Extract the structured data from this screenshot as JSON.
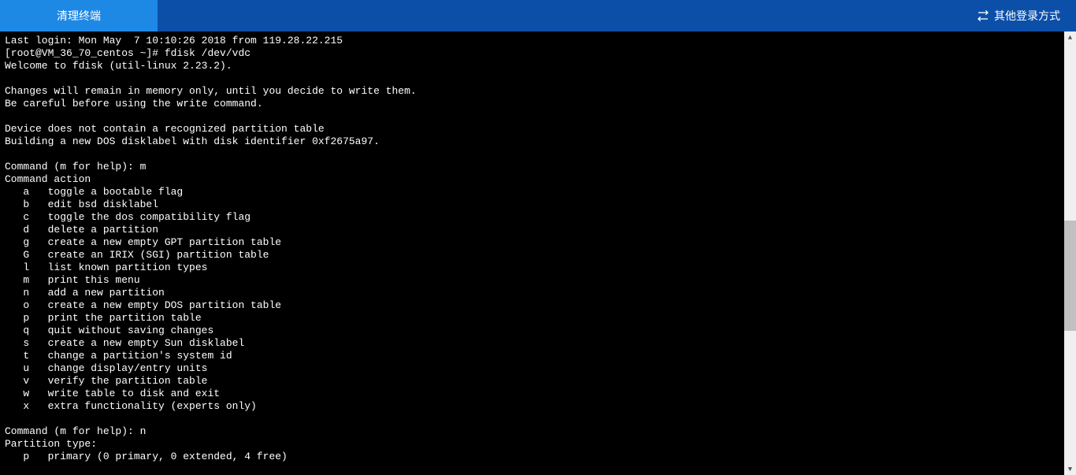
{
  "header": {
    "clear_button_label": "清理终端",
    "other_login_label": "其他登录方式"
  },
  "terminal": {
    "lines": [
      "Last login: Mon May  7 10:10:26 2018 from 119.28.22.215",
      "[root@VM_36_70_centos ~]# fdisk /dev/vdc",
      "Welcome to fdisk (util-linux 2.23.2).",
      "",
      "Changes will remain in memory only, until you decide to write them.",
      "Be careful before using the write command.",
      "",
      "Device does not contain a recognized partition table",
      "Building a new DOS disklabel with disk identifier 0xf2675a97.",
      "",
      "Command (m for help): m",
      "Command action",
      "   a   toggle a bootable flag",
      "   b   edit bsd disklabel",
      "   c   toggle the dos compatibility flag",
      "   d   delete a partition",
      "   g   create a new empty GPT partition table",
      "   G   create an IRIX (SGI) partition table",
      "   l   list known partition types",
      "   m   print this menu",
      "   n   add a new partition",
      "   o   create a new empty DOS partition table",
      "   p   print the partition table",
      "   q   quit without saving changes",
      "   s   create a new empty Sun disklabel",
      "   t   change a partition's system id",
      "   u   change display/entry units",
      "   v   verify the partition table",
      "   w   write table to disk and exit",
      "   x   extra functionality (experts only)",
      "",
      "Command (m for help): n",
      "Partition type:",
      "   p   primary (0 primary, 0 extended, 4 free)"
    ]
  }
}
